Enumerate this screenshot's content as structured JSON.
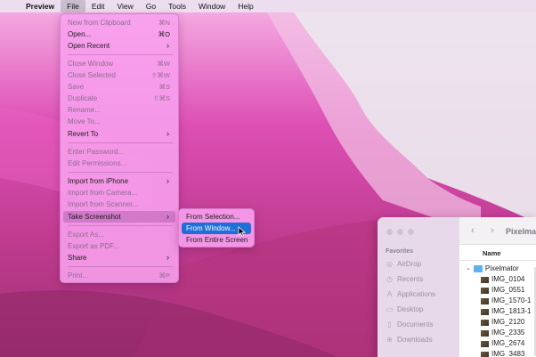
{
  "menubar": {
    "items": [
      "Preview",
      "File",
      "Edit",
      "View",
      "Go",
      "Tools",
      "Window",
      "Help"
    ]
  },
  "file_menu": {
    "items": [
      {
        "label": "New from Clipboard",
        "shortcut": "⌘N",
        "disabled": true
      },
      {
        "label": "Open...",
        "shortcut": "⌘O",
        "disabled": false
      },
      {
        "label": "Open Recent",
        "shortcut": "›",
        "disabled": false
      },
      {
        "label": "Close Window",
        "shortcut": "⌘W",
        "disabled": true
      },
      {
        "label": "Close Selected",
        "shortcut": "⇧⌘W",
        "disabled": true
      },
      {
        "label": "Save",
        "shortcut": "⌘S",
        "disabled": true
      },
      {
        "label": "Duplicate",
        "shortcut": "⇧⌘S",
        "disabled": true
      },
      {
        "label": "Rename...",
        "shortcut": "",
        "disabled": true
      },
      {
        "label": "Move To...",
        "shortcut": "",
        "disabled": true
      },
      {
        "label": "Revert To",
        "shortcut": "›",
        "disabled": false
      },
      {
        "label": "Enter Password...",
        "shortcut": "",
        "disabled": true
      },
      {
        "label": "Edit Permissions...",
        "shortcut": "",
        "disabled": true
      },
      {
        "label": "Import from iPhone",
        "shortcut": "›",
        "disabled": false
      },
      {
        "label": "Import from Camera...",
        "shortcut": "",
        "disabled": true
      },
      {
        "label": "Import from Scanner...",
        "shortcut": "",
        "disabled": true
      },
      {
        "label": "Take Screenshot",
        "shortcut": "›",
        "disabled": false
      },
      {
        "label": "Export As...",
        "shortcut": "",
        "disabled": true
      },
      {
        "label": "Export as PDF...",
        "shortcut": "",
        "disabled": true
      },
      {
        "label": "Share",
        "shortcut": "›",
        "disabled": false
      },
      {
        "label": "Print...",
        "shortcut": "⌘P",
        "disabled": true
      }
    ]
  },
  "screenshot_submenu": {
    "items": [
      "From Selection...",
      "From Window...",
      "From Entire Screen"
    ],
    "selected": "From Window..."
  },
  "finder": {
    "title": "Pixelmator",
    "sidebar_heading": "Favorites",
    "sidebar_items": [
      "AirDrop",
      "Recents",
      "Applications",
      "Desktop",
      "Documents",
      "Downloads"
    ],
    "column_header": "Name",
    "folder": "Pixelmator",
    "files": [
      "IMG_0104",
      "IMG_0551",
      "IMG_1570-1",
      "IMG_1813-1",
      "IMG_2120",
      "IMG_2335",
      "IMG_2674",
      "IMG_3483"
    ]
  },
  "colors": {
    "selection_blue": "#1f6fd8",
    "menu_pink": "#f8a0ee",
    "folder_blue": "#5ab2f0"
  }
}
